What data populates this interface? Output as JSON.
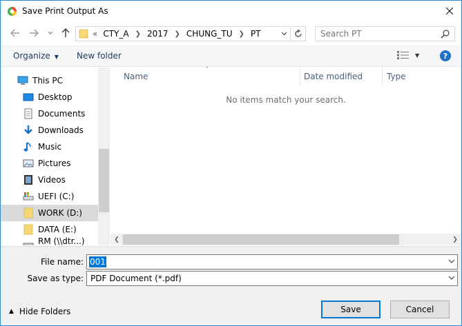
{
  "window": {
    "title": "Save Print Output As"
  },
  "address": {
    "prefix": "«",
    "crumbs": [
      "CTY_A",
      "2017",
      "CHUNG_TU",
      "PT"
    ]
  },
  "search": {
    "placeholder": "Search PT"
  },
  "toolbar": {
    "organize_label": "Organize",
    "new_folder_label": "New folder",
    "help_label": "?"
  },
  "nav": {
    "items": [
      {
        "label": "This PC",
        "icon": "this-pc-icon"
      },
      {
        "label": "Desktop",
        "icon": "desktop-icon"
      },
      {
        "label": "Documents",
        "icon": "documents-icon"
      },
      {
        "label": "Downloads",
        "icon": "downloads-icon"
      },
      {
        "label": "Music",
        "icon": "music-icon"
      },
      {
        "label": "Pictures",
        "icon": "pictures-icon"
      },
      {
        "label": "Videos",
        "icon": "videos-icon"
      },
      {
        "label": "UEFI (C:)",
        "icon": "drive-icon"
      },
      {
        "label": "WORK (D:)",
        "icon": "folder-icon"
      },
      {
        "label": "DATA (E:)",
        "icon": "folder-icon"
      },
      {
        "label": "RM (\\\\dtr...) (Z:)",
        "icon": "network-drive-icon"
      }
    ]
  },
  "files": {
    "columns": [
      "Name",
      "Date modified",
      "Type"
    ],
    "empty_message": "No items match your search."
  },
  "form": {
    "file_name_label": "File name:",
    "file_name_value": "001",
    "save_type_label": "Save as type:",
    "save_type_value": "PDF Document (*.pdf)"
  },
  "footer": {
    "hide_folders_label": "Hide Folders",
    "save_label": "Save",
    "cancel_label": "Cancel"
  },
  "colors": {
    "accent": "#0078d7",
    "folder": "#f8d775"
  }
}
